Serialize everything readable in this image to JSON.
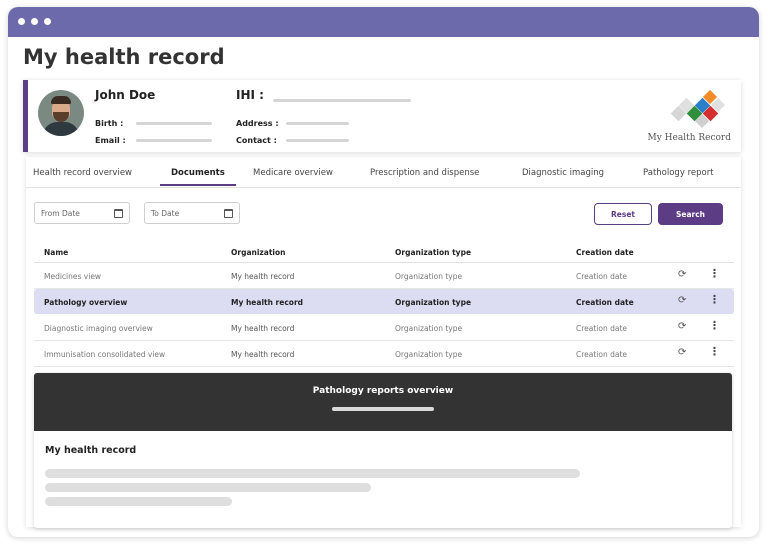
{
  "page": {
    "title": "My health record"
  },
  "patient": {
    "name": "John Doe",
    "ihi_label": "IHI :",
    "birth_label": "Birth :",
    "email_label": "Email :",
    "address_label": "Address :",
    "contact_label": "Contact :"
  },
  "logo": {
    "text": "My Health Record"
  },
  "tabs": [
    {
      "label": "Health record overview"
    },
    {
      "label": "Documents",
      "active": true
    },
    {
      "label": "Medicare overview"
    },
    {
      "label": "Prescription and dispense"
    },
    {
      "label": "Diagnostic imaging"
    },
    {
      "label": "Pathology report"
    }
  ],
  "filters": {
    "from_placeholder": "From Date",
    "to_placeholder": "To Date",
    "reset_label": "Reset",
    "search_label": "Search"
  },
  "table": {
    "columns": [
      "Name",
      "Organization",
      "Organization type",
      "Creation date"
    ],
    "rows": [
      {
        "name": "Medicines view",
        "organization": "My health record",
        "org_type": "Organization type",
        "date": "Creation date",
        "selected": false
      },
      {
        "name": "Pathology overview",
        "organization": "My health record",
        "org_type": "Organization type",
        "date": "Creation date",
        "selected": true
      },
      {
        "name": "Diagnostic imaging overview",
        "organization": "My health record",
        "org_type": "Organization type",
        "date": "Creation date",
        "selected": false
      },
      {
        "name": "Immunisation consolidated view",
        "organization": "My health record",
        "org_type": "Organization type",
        "date": "Creation date",
        "selected": false
      }
    ],
    "row_icons": [
      "refresh-icon",
      "more-vertical-icon"
    ]
  },
  "preview": {
    "title": "Pathology reports overview",
    "subtitle": "My health record"
  },
  "colors": {
    "titlebar": "#6c6aab",
    "accent": "#5d3c86",
    "selected_row": "#dcdcf3",
    "preview_header": "#333333"
  }
}
